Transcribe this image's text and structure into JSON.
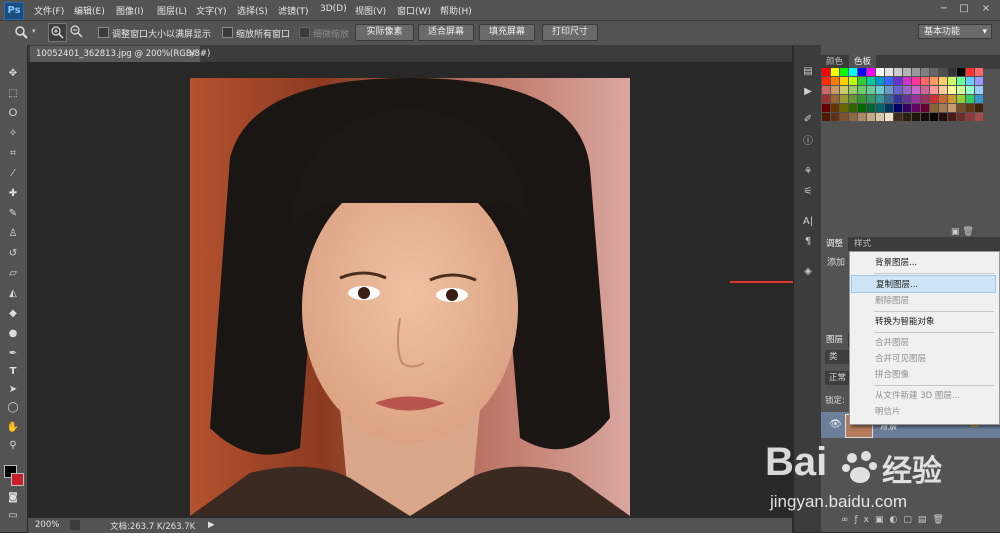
{
  "app": {
    "logo": "Ps"
  },
  "menubar": {
    "items": [
      "文件(F)",
      "编辑(E)",
      "图像(I)",
      "图层(L)",
      "文字(Y)",
      "选择(S)",
      "滤镜(T)",
      "3D(D)",
      "视图(V)",
      "窗口(W)",
      "帮助(H)"
    ],
    "window_controls": [
      "−",
      "□",
      "×"
    ]
  },
  "options": {
    "resize_windows": "调整窗口大小以满屏显示",
    "zoom_all": "缩放所有窗口",
    "scrubby_zoom": "细微缩放",
    "actual_pixels": "实际像素",
    "fit_screen": "适合屏幕",
    "fill_screen": "填充屏幕",
    "print_size": "打印尺寸",
    "workspace": "基本功能"
  },
  "document": {
    "tab_title": "10052401_362813.jpg @ 200%(RGB/8#)",
    "close": "×"
  },
  "status": {
    "zoom": "200%",
    "doc_size": "文档:263.7 K/263.7K"
  },
  "panels": {
    "color_tabs": [
      "颜色",
      "色板"
    ],
    "adjust_tabs": [
      "调整",
      "样式"
    ],
    "adjust_add": "添加",
    "layers_tab": "图层",
    "layers_kind": "类",
    "layers_mode": "正常",
    "layers_lock": "锁定:",
    "layer_name": "背景"
  },
  "context_menu": {
    "items": [
      {
        "label": "背景图层...",
        "enabled": true
      },
      {
        "label": "复制图层...",
        "enabled": true,
        "highlighted": true
      },
      {
        "label": "删除图层",
        "enabled": false
      },
      {
        "label": "转换为智能对象",
        "enabled": true
      },
      {
        "label": "合并图层",
        "enabled": false
      },
      {
        "label": "合并可见图层",
        "enabled": false
      },
      {
        "label": "拼合图像",
        "enabled": false
      },
      {
        "label": "从文件新建 3D 图层...",
        "enabled": false
      },
      {
        "label": "明信片",
        "enabled": false
      }
    ]
  },
  "watermark": {
    "brand": "Bai",
    "brand_suffix": "经验",
    "url": "jingyan.baidu.com"
  },
  "colors": {
    "arrow": "#e53030",
    "highlight": "#cde5f6",
    "ui_dark": "#535353"
  }
}
